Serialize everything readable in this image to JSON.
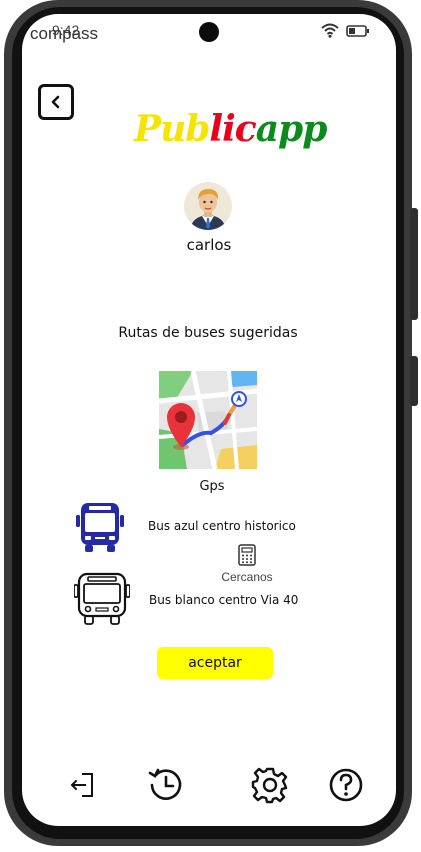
{
  "status_bar": {
    "time": "9:42",
    "app_label": "compass",
    "icons": [
      "wifi-icon",
      "battery-icon"
    ]
  },
  "header": {
    "back_icon": "chevron-left-icon",
    "logo_parts": [
      "Pub",
      "lic",
      "app"
    ],
    "logo_colors": [
      "#f5e400",
      "#e8001c",
      "#0c8a1e"
    ]
  },
  "profile": {
    "username": "carlos"
  },
  "main": {
    "title": "Rutas de buses sugeridas",
    "gps_label": "Gps",
    "routes": [
      {
        "label": "Bus azul centro historico",
        "icon": "blue-bus-icon",
        "color": "#242aa6"
      },
      {
        "label": "Bus blanco centro Via 40",
        "icon": "white-bus-icon",
        "color": "#111111"
      }
    ],
    "nearby_label": "Cercanos",
    "accept_label": "aceptar"
  },
  "bottom_nav": {
    "items": [
      "logout-icon",
      "history-icon",
      "settings-icon",
      "help-icon"
    ]
  }
}
